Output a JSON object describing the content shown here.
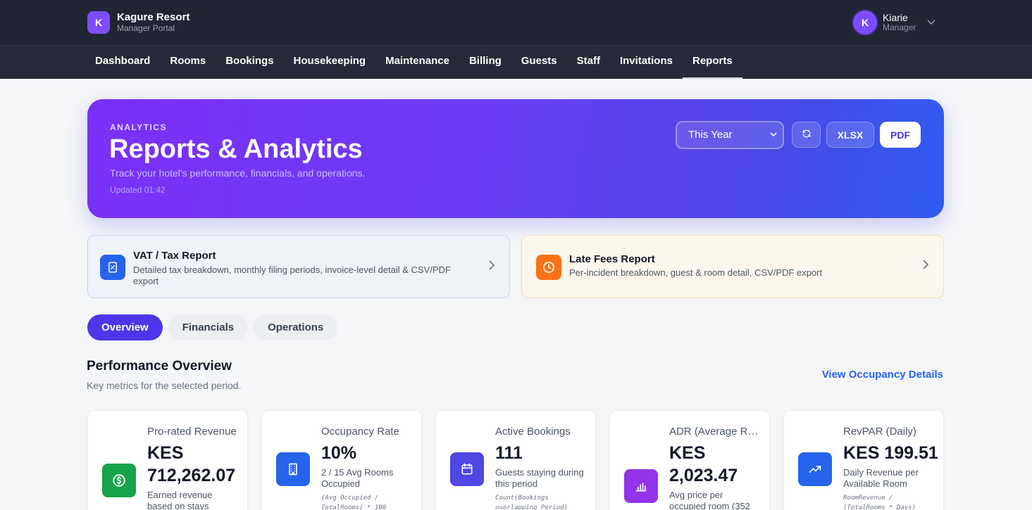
{
  "brand": {
    "logo_letter": "K",
    "name": "Kagure Resort",
    "subtitle": "Manager Portal"
  },
  "user": {
    "avatar_letter": "K",
    "name": "Kiarie",
    "role": "Manager"
  },
  "nav": {
    "items": [
      {
        "label": "Dashboard"
      },
      {
        "label": "Rooms"
      },
      {
        "label": "Bookings"
      },
      {
        "label": "Housekeeping"
      },
      {
        "label": "Maintenance"
      },
      {
        "label": "Billing"
      },
      {
        "label": "Guests"
      },
      {
        "label": "Staff"
      },
      {
        "label": "Invitations"
      },
      {
        "label": "Reports"
      }
    ],
    "active": "Reports"
  },
  "hero": {
    "eyebrow": "ANALYTICS",
    "title": "Reports & Analytics",
    "subtitle": "Track your hotel's performance, financials, and operations.",
    "updated": "Updated 01:42",
    "period_select": "This Year",
    "xlsx_label": "XLSX",
    "pdf_label": "PDF",
    "gradient_colors": [
      "#7b2ff7",
      "#4f46e5",
      "#2f5bf0"
    ]
  },
  "report_cards": {
    "vat": {
      "title": "VAT / Tax Report",
      "description": "Detailed tax breakdown, monthly filing periods, invoice-level detail & CSV/PDF export",
      "icon": "receipt-icon",
      "color": "#2563eb"
    },
    "late_fees": {
      "title": "Late Fees Report",
      "description": "Per-incident breakdown, guest & room detail, CSV/PDF export",
      "icon": "clock-icon",
      "color": "#f97316"
    }
  },
  "tabs": [
    {
      "label": "Overview",
      "active": true
    },
    {
      "label": "Financials",
      "active": false
    },
    {
      "label": "Operations",
      "active": false
    }
  ],
  "section": {
    "title": "Performance Overview",
    "subtitle": "Key metrics for the selected period.",
    "link": "View Occupancy Details"
  },
  "kpis": [
    {
      "label": "Pro-rated Revenue",
      "value": "KES 712,262.07",
      "description": "Earned revenue based on stays",
      "formula": "",
      "icon": "dollar-icon",
      "color": "#16a34a"
    },
    {
      "label": "Occupancy Rate",
      "value": "10%",
      "description": "2 / 15 Avg Rooms Occupied",
      "formula": "(Avg Occupied / TotalRooms) * 100",
      "icon": "building-icon",
      "color": "#2563eb"
    },
    {
      "label": "Active Bookings",
      "value": "111",
      "description": "Guests staying during this period",
      "formula": "Count(Bookings overlapping Period)",
      "icon": "calendar-icon",
      "color": "#4f46e5"
    },
    {
      "label": "ADR (Average Rate)",
      "value": "KES 2,023.47",
      "description": "Avg price per occupied room (352",
      "formula": "",
      "icon": "bar-chart-icon",
      "color": "#9333ea"
    },
    {
      "label": "RevPAR (Daily)",
      "value": "KES 199.51",
      "description": "Daily Revenue per Available Room",
      "formula": "RoomRevenue / (TotalRooms * Days)",
      "icon": "trending-up-icon",
      "color": "#2563eb"
    }
  ]
}
